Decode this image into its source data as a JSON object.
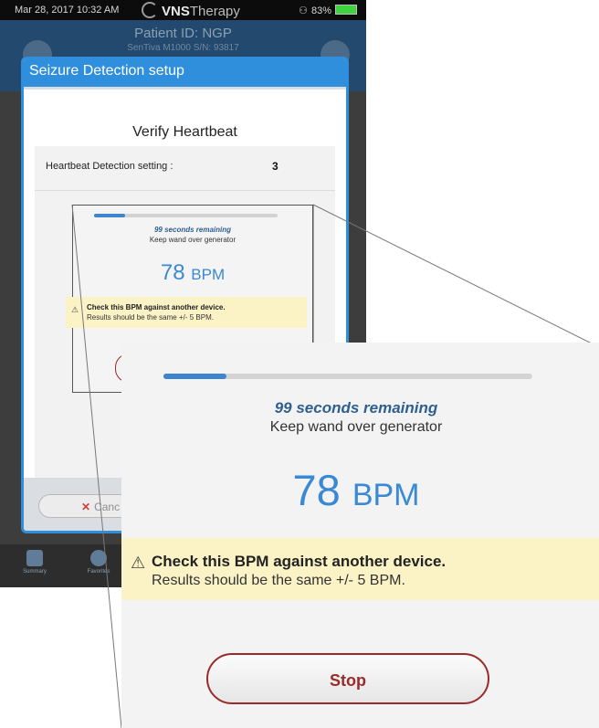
{
  "status_bar": {
    "datetime": "Mar 28, 2017  10:32 AM",
    "brand_bold": "VNS",
    "brand_light": "Therapy",
    "battery": "83%",
    "colors": {
      "battery": "#3fd43f"
    }
  },
  "app_header": {
    "patient_id": "Patient ID: NGP",
    "serial": "SenTiva M1000 S/N: 93817",
    "color": "#234a6e"
  },
  "bottom_nav": {
    "items": [
      {
        "label": "Summary",
        "icon": "summary-icon"
      },
      {
        "label": "Favorites",
        "icon": "favorites-icon"
      }
    ]
  },
  "modal": {
    "title": "Seizure Detection setup",
    "heading": "Verify Heartbeat",
    "setting_label": "Heartbeat Detection setting :",
    "setting_value": "3",
    "cancel_label": "Canc",
    "accent_color": "#2f8fdc"
  },
  "heartbeat": {
    "progress_fraction": 0.17,
    "remaining": "99 seconds remaining",
    "instruction": "Keep wand over generator",
    "bpm_value": "78",
    "bpm_unit": "BPM",
    "warning_title": "Check this BPM against another device.",
    "warning_detail": "Results should be the same +/- 5 BPM.",
    "stop_label": "Stop",
    "colors": {
      "bpm": "#3a89d4",
      "warning_bg": "#fbf3c6",
      "stop": "#9b2a2a"
    }
  }
}
